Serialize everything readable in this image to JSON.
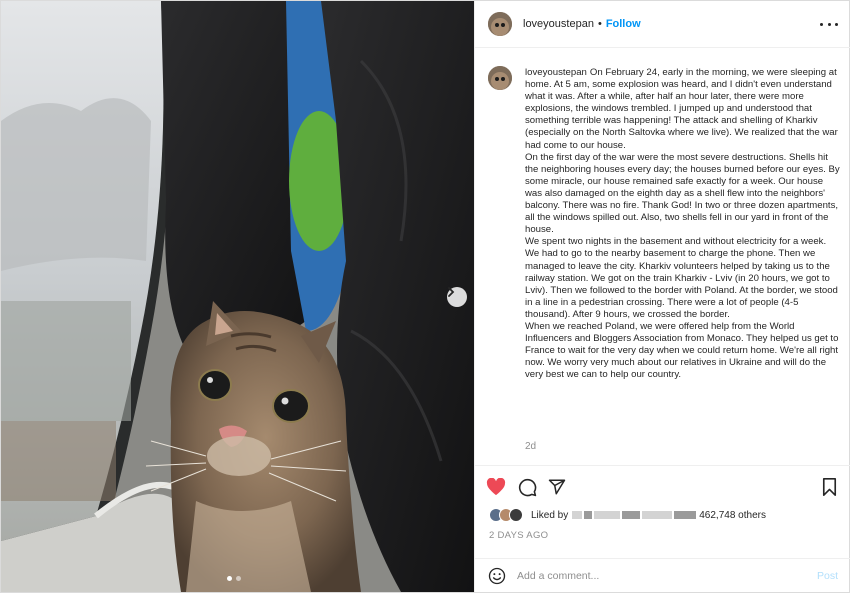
{
  "post": {
    "username": "loveyoustepan",
    "header_separator": "•",
    "follow_label": "Follow",
    "more_icon": "more-options-icon",
    "caption_paragraphs": [
      "On February 24, early in the morning, we were sleeping at home. At 5 am, some explosion was heard, and I didn't even understand what it was. After a while, after half an hour later, there were more explosions, the windows trembled. I jumped up and understood that something terrible was happening! The attack and shelling of Kharkiv (especially on the North Saltovka where we live). We realized that the war had come to our house.",
      "On the first day of the war were the most severe destructions. Shells hit the neighboring houses every day; the houses burned before our eyes. By some miracle, our house remained safe exactly for a week. Our house was also damaged on the eighth day as a shell flew into the neighbors' balcony. There was no fire. Thank God! In two or three dozen apartments, all the windows spilled out. Also, two shells fell in our yard in front of the house.",
      "We spent two nights in the basement and without electricity for a week. We had to go to the nearby basement to charge the phone. Then we managed to leave the city. Kharkiv volunteers helped by taking us to the railway station. We got on the train Kharkiv - Lviv (in 20 hours, we got to Lviv). Then we followed to the border with Poland. At the border, we stood in a line in a pedestrian crossing. There were a lot of people (4-5 thousand). After 9 hours, we crossed the border.",
      "When we reached Poland, we were offered help from the World Influencers and Bloggers Association from Monaco. They helped us get to France to wait for the very day when we could return home. We're all right now. We worry very much about our relatives in Ukraine and will do the very best we can to help our country."
    ],
    "caption_age": "2d",
    "liked_by_prefix": "Liked by",
    "likes_count_text": "462,748 others",
    "date": "2 DAYS AGO",
    "comment_placeholder": "Add a comment...",
    "post_label": "Post",
    "colors": {
      "accent": "#0095f6",
      "like_red": "#ed4956",
      "post_disabled": "#b2dffc",
      "muted": "#8e8e8e"
    },
    "icons": [
      "heart-icon",
      "comment-icon",
      "share-icon",
      "bookmark-icon",
      "emoji-icon",
      "chevron-right-icon"
    ],
    "carousel": {
      "slides": 2,
      "current": 1
    }
  }
}
